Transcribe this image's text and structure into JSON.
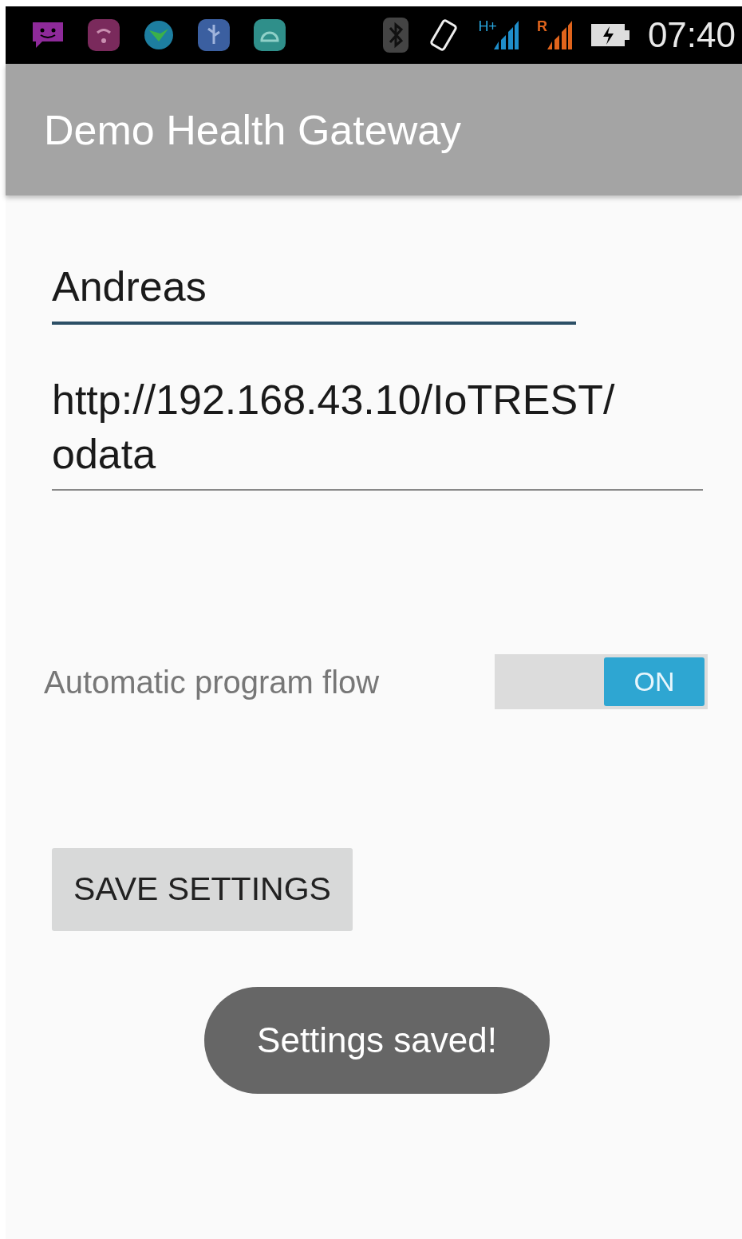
{
  "status_bar": {
    "network_type": "H+",
    "roaming": "R",
    "time": "07:40"
  },
  "app_bar": {
    "title": "Demo Health Gateway"
  },
  "fields": [
    {
      "value": "Andreas",
      "focused": true
    },
    {
      "value": "http://192.168.43.10/IoTREST/odata",
      "focused": false
    }
  ],
  "switch": {
    "label": "Automatic program flow",
    "on": true,
    "state_text": "ON"
  },
  "save_button": {
    "label": "SAVE SETTINGS"
  },
  "toast": {
    "text": "Settings saved!"
  }
}
